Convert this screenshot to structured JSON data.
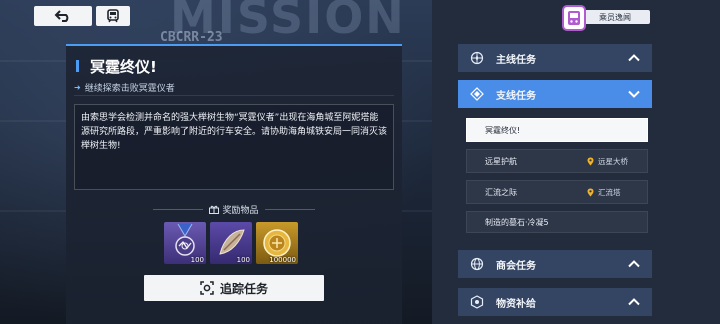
{
  "background": {
    "big_word": "MISSION",
    "code": "CBCRR-23"
  },
  "top_bar": {
    "back_icon": "back-arrow-icon",
    "train_icon": "train-icon"
  },
  "mission": {
    "title": "冥霆终仪!",
    "objective": "继续探索击败冥霆仪者",
    "description": "由索思学会检测并命名的强大榉树生物“冥霆仪者”出现在海角城至阿妮塔能源研究所路段，严重影响了附近的行车安全。请协助海角城铁安局一同消灭该榉树生物!",
    "rewards_label": "奖励物品",
    "rewards": [
      {
        "name": "medal",
        "count": "100"
      },
      {
        "name": "blade",
        "count": "100"
      },
      {
        "name": "coin",
        "count": "100000"
      }
    ],
    "track_button": "追踪任务"
  },
  "right_panel": {
    "crew_tab": "乘员逸闻",
    "categories": [
      {
        "key": "main",
        "label": "主线任务",
        "icon": "compass-icon",
        "state": "collapsed"
      },
      {
        "key": "side",
        "label": "支线任务",
        "icon": "diamond-icon",
        "state": "expanded"
      },
      {
        "key": "guild",
        "label": "商会任务",
        "icon": "globe-icon",
        "state": "collapsed"
      },
      {
        "key": "supply",
        "label": "物资补给",
        "icon": "supply-icon",
        "state": "collapsed"
      }
    ],
    "side_quests": [
      {
        "label": "冥霆终仪!",
        "location": ""
      },
      {
        "label": "远星护航",
        "location": "远星大桥"
      },
      {
        "label": "汇流之际",
        "location": "汇流塔"
      },
      {
        "label": "制造的墓石·冷凝5",
        "location": ""
      }
    ],
    "colors": {
      "active": "#4a8de8",
      "category": "#344463",
      "pin": "#f2b32c"
    }
  }
}
